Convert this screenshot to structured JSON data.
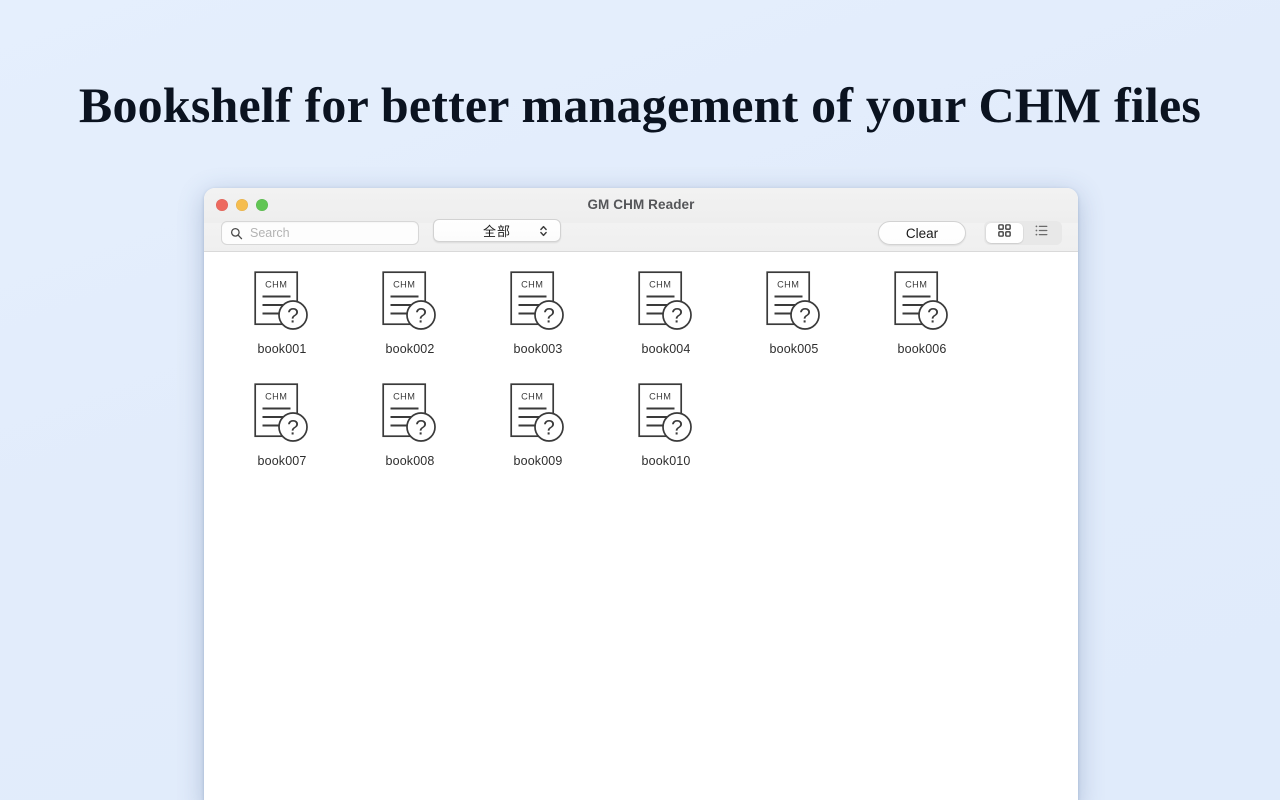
{
  "headline": "Bookshelf for better management of your CHM files",
  "window": {
    "title": "GM CHM Reader",
    "traffic_lights": [
      {
        "name": "close",
        "color": "#ed6a5f"
      },
      {
        "name": "minimize",
        "color": "#f5bd4f"
      },
      {
        "name": "maximize",
        "color": "#61c554"
      }
    ]
  },
  "toolbar": {
    "search": {
      "placeholder": "Search",
      "value": "",
      "icon": "search-icon"
    },
    "filter": {
      "selected": "全部",
      "icon": "chevron-up-down-icon"
    },
    "clear_label": "Clear",
    "view_modes": [
      {
        "name": "grid-view",
        "icon": "grid-icon",
        "active": true
      },
      {
        "name": "list-view",
        "icon": "list-icon",
        "active": false
      }
    ]
  },
  "books": [
    {
      "label": "book001",
      "badge": "CHM",
      "status_icon": "question-mark-icon"
    },
    {
      "label": "book002",
      "badge": "CHM",
      "status_icon": "question-mark-icon"
    },
    {
      "label": "book003",
      "badge": "CHM",
      "status_icon": "question-mark-icon"
    },
    {
      "label": "book004",
      "badge": "CHM",
      "status_icon": "question-mark-icon"
    },
    {
      "label": "book005",
      "badge": "CHM",
      "status_icon": "question-mark-icon"
    },
    {
      "label": "book006",
      "badge": "CHM",
      "status_icon": "question-mark-icon"
    },
    {
      "label": "book007",
      "badge": "CHM",
      "status_icon": "question-mark-icon"
    },
    {
      "label": "book008",
      "badge": "CHM",
      "status_icon": "question-mark-icon"
    },
    {
      "label": "book009",
      "badge": "CHM",
      "status_icon": "question-mark-icon"
    },
    {
      "label": "book010",
      "badge": "CHM",
      "status_icon": "question-mark-icon"
    }
  ],
  "colors": {
    "page_background": "#e3eefc",
    "window_background": "#ffffff",
    "toolbar_background": "#f0f0f0",
    "icon_stroke": "#3a3a3a",
    "title_text": "#555659"
  }
}
